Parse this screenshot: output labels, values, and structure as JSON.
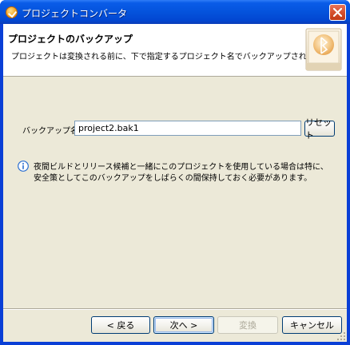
{
  "window": {
    "title": "プロジェクトコンバータ"
  },
  "header": {
    "title": "プロジェクトのバックアップ",
    "description": "プロジェクトは変換される前に、下で指定するプロジェクト名でバックアップされます。"
  },
  "form": {
    "backup_label": "バックアップ名:",
    "backup_value": "project2.bak1",
    "reset_label": "リセット"
  },
  "info": {
    "lines": [
      "夜間ビルドとリリース候補と一緒にこのプロジェクトを使用している場合は特に、",
      "安全策としてこのバックアップをしばらくの間保持しておく必要があります。"
    ]
  },
  "buttons": {
    "back": "< 戻る",
    "next": "次へ >",
    "convert": "変換",
    "cancel": "キャンセル"
  },
  "colors": {
    "titlebar": "#0453dc",
    "dialog_bg": "#ece9d8",
    "button_border": "#003c74"
  }
}
